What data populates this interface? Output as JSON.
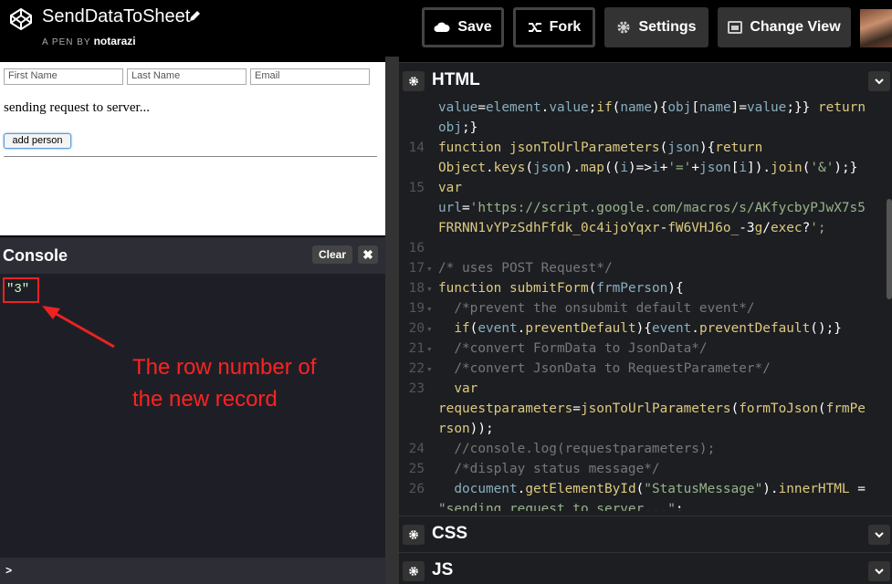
{
  "header": {
    "pen_title": "SendDataToSheet",
    "pen_by_label": "A PEN BY",
    "author": "notarazi",
    "buttons": {
      "save": "Save",
      "fork": "Fork",
      "settings": "Settings",
      "change_view": "Change View"
    }
  },
  "preview": {
    "first_name_placeholder": "First Name",
    "last_name_placeholder": "Last Name",
    "email_placeholder": "Email",
    "status_message": "sending request to server...",
    "add_button": "add person"
  },
  "console": {
    "title": "Console",
    "clear_label": "Clear",
    "close_label": "✖",
    "output": "\"3\"",
    "prompt": ">",
    "annotation_line1": "The row number of",
    "annotation_line2": "the new record"
  },
  "editor": {
    "html_title": "HTML",
    "css_title": "CSS",
    "js_title": "JS",
    "line_numbers": [
      "",
      "",
      "14",
      "",
      "15",
      "",
      "",
      "16",
      "17",
      "18",
      "19",
      "20",
      "21",
      "22",
      "23",
      "",
      "",
      "24",
      "25",
      "26",
      ""
    ],
    "code_lines": [
      "value=element.value;if(name){obj[name]=value;}} return",
      "obj;}",
      "function jsonToUrlParameters(json){return",
      "Object.keys(json).map((i)=>i+'='+json[i]).join('&');}",
      "var",
      "url='https://script.google.com/macros/s/AKfycbyPJwX7s5",
      "FRRNN1vYPzSdhFfdk_0c4ijoYqxr-fW6VHJ6o_-3g/exec?';",
      "",
      "/* uses POST Request*/",
      "function submitForm(frmPerson){",
      "  /*prevent the onsubmit default event*/",
      "  if(event.preventDefault){event.preventDefault();}",
      "  /*convert FormData to JsonData*/",
      "  /*convert JsonData to RequestParameter*/",
      "  var",
      "requestparameters=jsonToUrlParameters(formToJson(frmPe",
      "rson));",
      "  //console.log(requestparameters);",
      "  /*display status message*/",
      "  document.getElementById(\"StatusMessage\").innerHTML =",
      "\"sending request to server...\";"
    ]
  },
  "colors": {
    "keyword": "#ddca7e",
    "variable": "#88afbf",
    "string": "#96b38a",
    "comment": "#777777",
    "annotation": "#ff2222"
  }
}
